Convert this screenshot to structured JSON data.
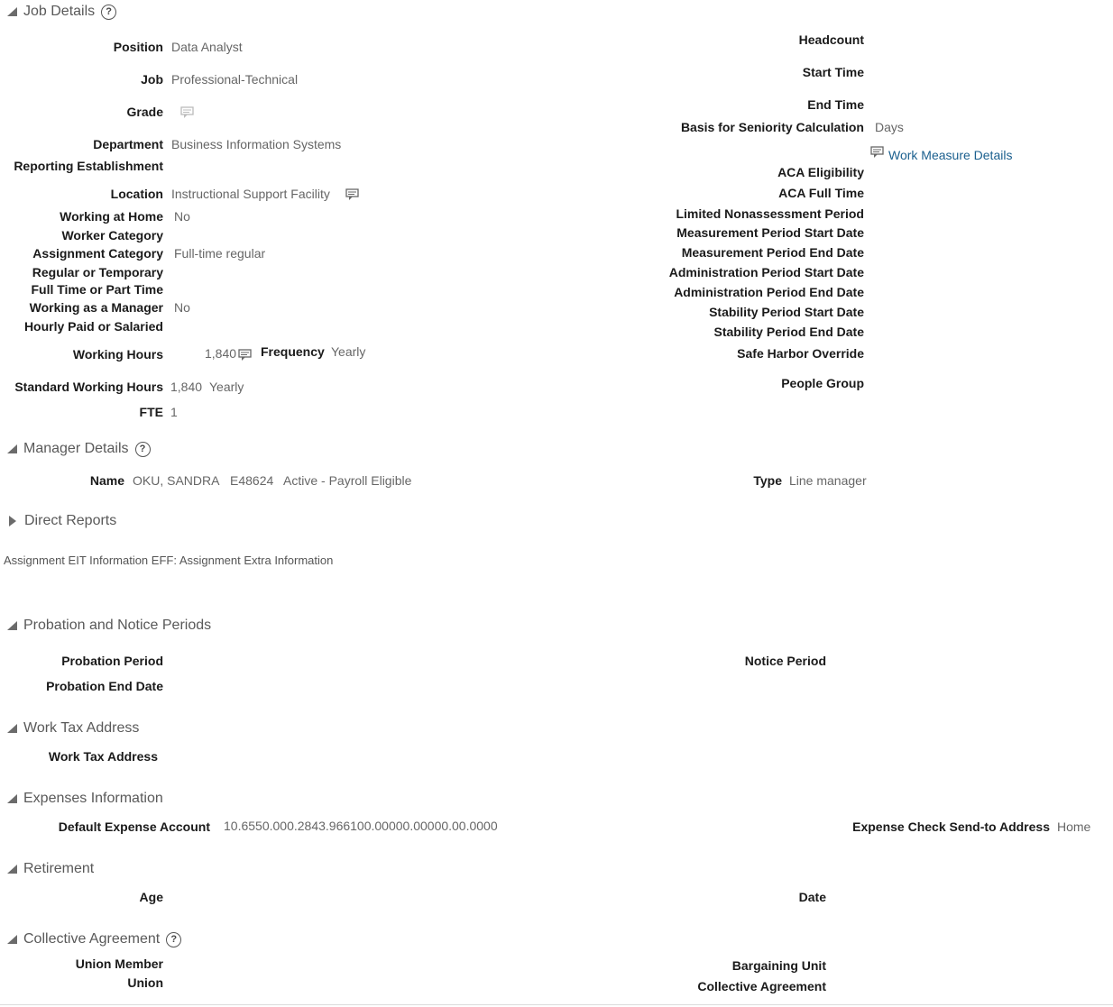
{
  "job_details": {
    "title": "Job Details",
    "left": {
      "position": {
        "label": "Position",
        "value": "Data Analyst"
      },
      "job": {
        "label": "Job",
        "value": "Professional-Technical"
      },
      "grade": {
        "label": "Grade"
      },
      "department": {
        "label": "Department",
        "value": "Business Information Systems"
      },
      "reporting_establishment": {
        "label": "Reporting Establishment"
      },
      "location": {
        "label": "Location",
        "value": "Instructional Support Facility"
      },
      "working_at_home": {
        "label": "Working at Home",
        "value": "No"
      },
      "worker_category": {
        "label": "Worker Category"
      },
      "assignment_category": {
        "label": "Assignment Category",
        "value": "Full-time regular"
      },
      "regular_or_temporary": {
        "label": "Regular or Temporary"
      },
      "full_or_part_time": {
        "label": "Full Time or Part Time"
      },
      "working_as_manager": {
        "label": "Working as a Manager",
        "value": "No"
      },
      "hourly_or_salaried": {
        "label": "Hourly Paid or Salaried"
      },
      "working_hours": {
        "label": "Working Hours",
        "value": "1,840",
        "frequency_label": "Frequency",
        "frequency_value": "Yearly"
      },
      "standard_working_hours": {
        "label": "Standard Working Hours",
        "value": "1,840",
        "unit": "Yearly"
      },
      "fte": {
        "label": "FTE",
        "value": "1"
      }
    },
    "right": {
      "headcount": {
        "label": "Headcount"
      },
      "start_time": {
        "label": "Start Time"
      },
      "end_time": {
        "label": "End Time"
      },
      "seniority_basis": {
        "label": "Basis for Seniority Calculation",
        "value": "Days"
      },
      "work_measure_link": "Work Measure Details",
      "aca_eligibility": {
        "label": "ACA Eligibility"
      },
      "aca_full_time": {
        "label": "ACA Full Time"
      },
      "limited_nonassessment": {
        "label": "Limited Nonassessment Period"
      },
      "measurement_start": {
        "label": "Measurement Period Start Date"
      },
      "measurement_end": {
        "label": "Measurement Period End Date"
      },
      "administration_start": {
        "label": "Administration Period Start Date"
      },
      "administration_end": {
        "label": "Administration Period End Date"
      },
      "stability_start": {
        "label": "Stability Period Start Date"
      },
      "stability_end": {
        "label": "Stability Period End Date"
      },
      "safe_harbor": {
        "label": "Safe Harbor Override"
      },
      "people_group": {
        "label": "People Group"
      }
    }
  },
  "manager_details": {
    "title": "Manager Details",
    "name_label": "Name",
    "name_value": "OKU, SANDRA",
    "employee_id": "E48624",
    "status": "Active - Payroll Eligible",
    "type_label": "Type",
    "type_value": "Line manager"
  },
  "direct_reports": {
    "title": "Direct Reports"
  },
  "assignment_eit": "Assignment EIT Information EFF: Assignment Extra Information",
  "probation": {
    "title": "Probation and Notice Periods",
    "probation_period": "Probation Period",
    "probation_end": "Probation End Date",
    "notice_period": "Notice Period"
  },
  "work_tax": {
    "title": "Work Tax Address",
    "label": "Work Tax Address"
  },
  "expenses": {
    "title": "Expenses Information",
    "account_label": "Default Expense Account",
    "account_value": "10.6550.000.2843.966100.00000.00000.00.0000",
    "send_to_label": "Expense Check Send-to Address",
    "send_to_value": "Home"
  },
  "retirement": {
    "title": "Retirement",
    "age": "Age",
    "date": "Date"
  },
  "collective": {
    "title": "Collective Agreement",
    "union_member": "Union Member",
    "union": "Union",
    "bargaining_unit": "Bargaining Unit",
    "collective_agreement": "Collective Agreement"
  },
  "icons": {
    "help": "?",
    "details": "details-icon"
  }
}
